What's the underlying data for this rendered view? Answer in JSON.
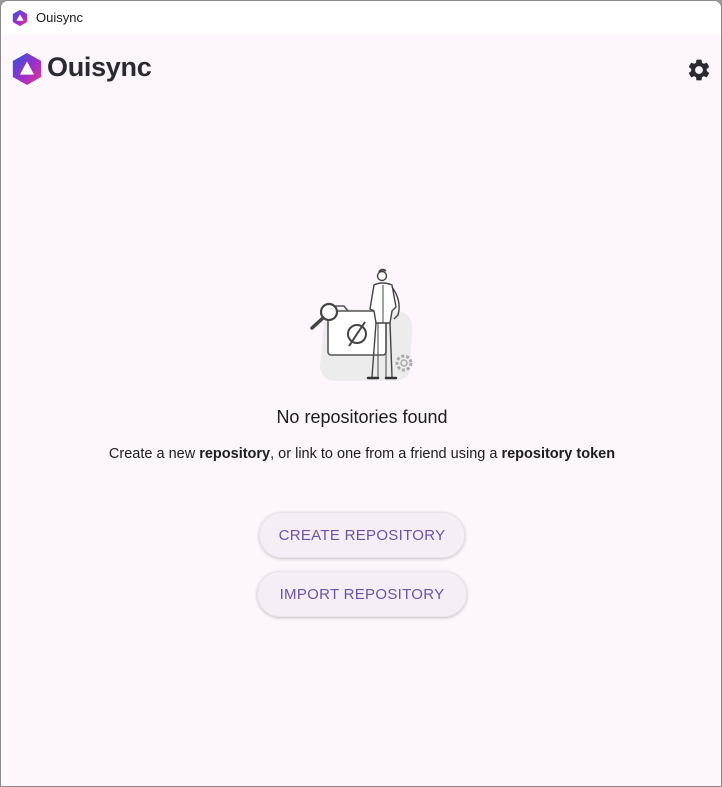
{
  "window": {
    "title": "Ouisync"
  },
  "appbar": {
    "logo_text": "Ouisync",
    "settings_icon": "gear-icon"
  },
  "empty_state": {
    "illustration_icon": "no-repositories-illustration",
    "title": "No repositories found",
    "description": {
      "part1": "Create a new ",
      "bold1": "repository",
      "part2": ", or link to one from a friend using a ",
      "bold2": "repository token"
    }
  },
  "actions": {
    "create_label": "CREATE REPOSITORY",
    "import_label": "IMPORT REPOSITORY"
  },
  "colors": {
    "background": "#fdf6fc",
    "button_text": "#6b54a3",
    "button_bg": "#f6eef6",
    "logo_gradient": [
      "#2d55d9",
      "#9b2fc9",
      "#e53a8c"
    ]
  }
}
